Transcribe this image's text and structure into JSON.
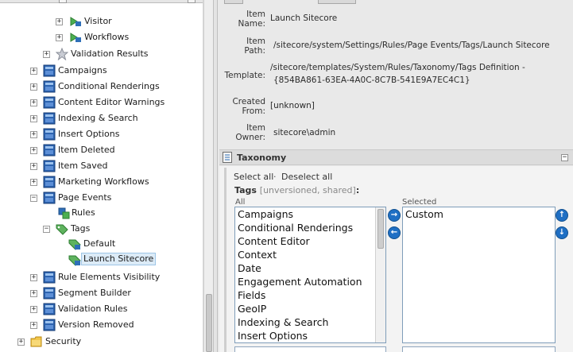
{
  "tree": {
    "items": [
      {
        "label": "Visitor",
        "expander": "+",
        "icon": "rule-folder-icon"
      },
      {
        "label": "Workflows",
        "expander": "+",
        "icon": "rule-folder-icon"
      },
      {
        "label": "Validation Results",
        "expander": "+",
        "icon": "star-icon"
      },
      {
        "label": "Campaigns",
        "expander": "+",
        "icon": "folder-icon"
      },
      {
        "label": "Conditional Renderings",
        "expander": "+",
        "icon": "folder-icon"
      },
      {
        "label": "Content Editor Warnings",
        "expander": "+",
        "icon": "folder-icon"
      },
      {
        "label": "Indexing & Search",
        "expander": "+",
        "icon": "folder-icon"
      },
      {
        "label": "Insert Options",
        "expander": "+",
        "icon": "folder-icon"
      },
      {
        "label": "Item Deleted",
        "expander": "+",
        "icon": "folder-icon"
      },
      {
        "label": "Item Saved",
        "expander": "+",
        "icon": "folder-icon"
      },
      {
        "label": "Marketing Workflows",
        "expander": "+",
        "icon": "folder-icon"
      },
      {
        "label": "Page Events",
        "expander": "−",
        "icon": "folder-icon"
      },
      {
        "label": "Rules",
        "expander": "",
        "icon": "rules-icon"
      },
      {
        "label": "Tags",
        "expander": "−",
        "icon": "tags-icon"
      },
      {
        "label": "Default",
        "expander": "",
        "icon": "tag-item-icon"
      },
      {
        "label": "Launch Sitecore",
        "expander": "",
        "icon": "tag-item-icon"
      },
      {
        "label": "Rule Elements Visibility",
        "expander": "+",
        "icon": "folder-icon"
      },
      {
        "label": "Segment Builder",
        "expander": "+",
        "icon": "folder-icon"
      },
      {
        "label": "Validation Rules",
        "expander": "+",
        "icon": "folder-icon"
      },
      {
        "label": "Version Removed",
        "expander": "+",
        "icon": "folder-icon"
      },
      {
        "label": "Security",
        "expander": "+",
        "icon": "yellow-folder-icon"
      }
    ]
  },
  "info": {
    "item_name_label": "Item\nName:",
    "item_name": "Launch Sitecore",
    "item_path_label": "Item\nPath:",
    "item_path": "/sitecore/system/Settings/Rules/Page Events/Tags/Launch Sitecore",
    "template_label": "Template:",
    "template_path": "/sitecore/templates/System/Rules/Taxonomy/Tags Definition -",
    "template_id": "{854BA861-63EA-4A0C-8C7B-541E9A7EC4C1}",
    "created_from_label": "Created\nFrom:",
    "created_from": "[unknown]",
    "item_owner_label": "Item\nOwner:",
    "item_owner": "sitecore\\admin"
  },
  "section": {
    "title": "Taxonomy",
    "collapse_glyph": "−",
    "select_all": "Select all",
    "separator": "·",
    "deselect_all": "Deselect all",
    "field_name": "Tags",
    "field_meta": "[unversioned, shared]",
    "field_colon": ":",
    "all_caption": "All",
    "selected_caption": "Selected",
    "all_items": [
      "Campaigns",
      "Conditional Renderings",
      "Content Editor",
      "Context",
      "Date",
      "Engagement Automation",
      "Fields",
      "GeoIP",
      "Indexing & Search",
      "Insert Options"
    ],
    "selected_items": [
      "Custom"
    ]
  },
  "colors": {
    "accent_blue": "#1f6fc4",
    "selection_bg": "#dcebf7"
  }
}
